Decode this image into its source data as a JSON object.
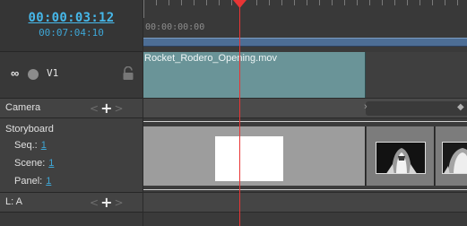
{
  "timecode": {
    "current": "00:00:03:12",
    "duration": "00:07:04:10"
  },
  "tracks": {
    "v1": {
      "label": "V1"
    },
    "camera": {
      "label": "Camera",
      "prev": "<",
      "add": "+",
      "next": ">"
    },
    "storyboard": {
      "title": "Storyboard",
      "seq_label": "Seq.:",
      "seq_value": "1",
      "scene_label": "Scene:",
      "scene_value": "1",
      "panel_label": "Panel:",
      "panel_value": "1"
    },
    "la": {
      "label": "L: A",
      "prev": "<",
      "add": "+",
      "next": ">"
    }
  },
  "timeline": {
    "ruler_start": "00:00:00:00",
    "clip_name": "Rocket_Rodero_Opening.mov",
    "playhead_color": "#e83535",
    "accent_color": "#46b8ea"
  }
}
